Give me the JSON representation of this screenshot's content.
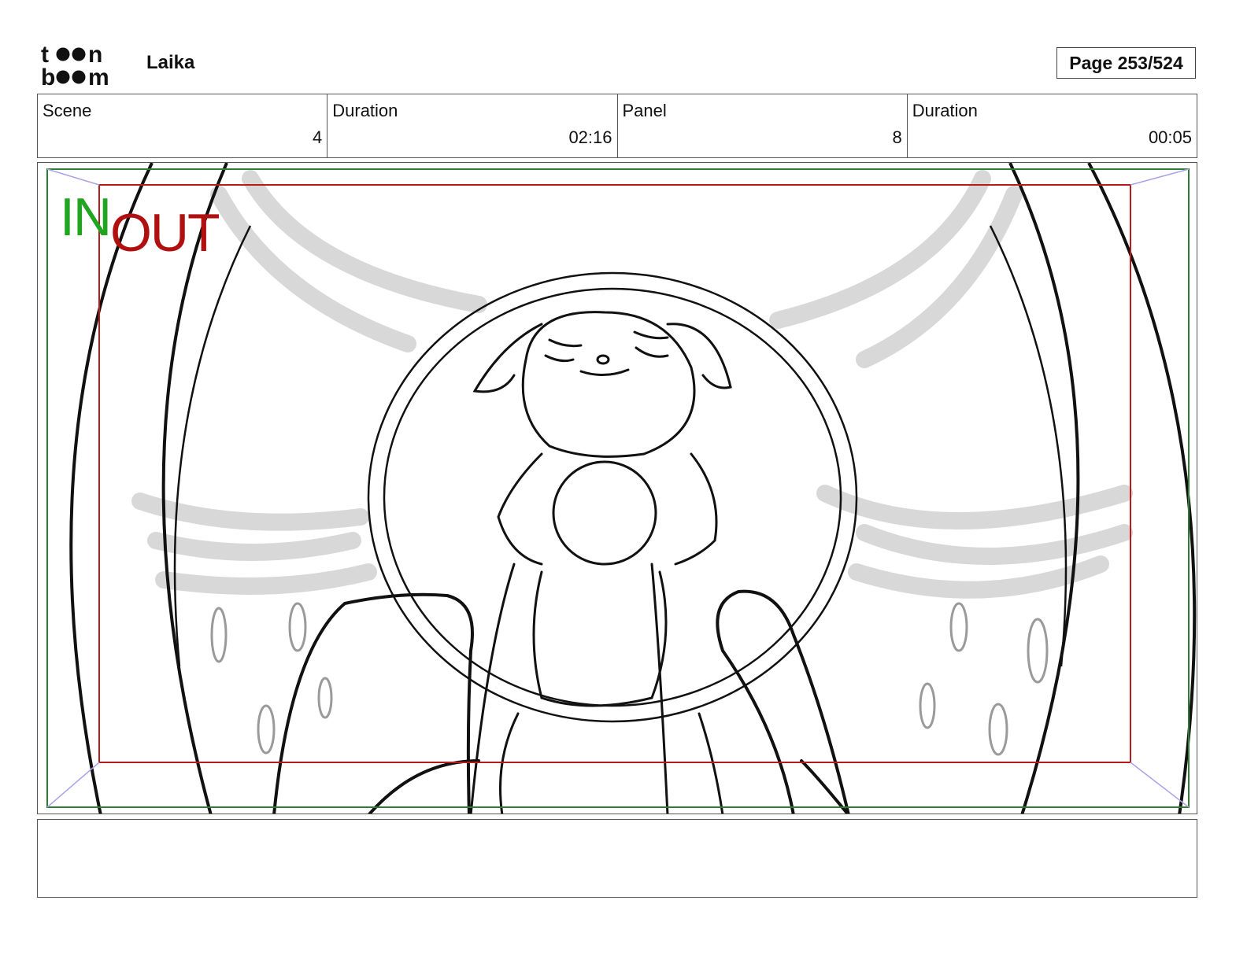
{
  "header": {
    "logo_text": "toon boom",
    "project_title": "Laika",
    "page_indicator": "Page 253/524"
  },
  "info": {
    "scene_label": "Scene",
    "scene_value": "4",
    "scene_duration_label": "Duration",
    "scene_duration_value": "02:16",
    "panel_label": "Panel",
    "panel_value": "8",
    "panel_duration_label": "Duration",
    "panel_duration_value": "00:05"
  },
  "panel": {
    "in_label": "IN",
    "out_label": "OUT",
    "in_color": "#1fa51f",
    "out_color": "#b01010",
    "safe_frame_color": "#2e7d32",
    "camera_frame_color": "#b71c1c",
    "sketch_color": "#111111"
  },
  "notes": {
    "text": ""
  }
}
